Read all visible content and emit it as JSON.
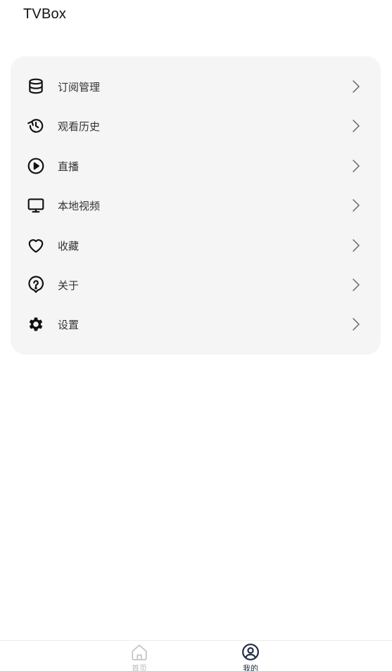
{
  "app": {
    "title": "TVBox"
  },
  "menu": {
    "items": [
      {
        "label": "订阅管理",
        "icon": "database-icon"
      },
      {
        "label": "观看历史",
        "icon": "history-icon"
      },
      {
        "label": "直播",
        "icon": "play-circle-icon"
      },
      {
        "label": "本地视频",
        "icon": "monitor-icon"
      },
      {
        "label": "收藏",
        "icon": "heart-icon"
      },
      {
        "label": "关于",
        "icon": "help-icon"
      },
      {
        "label": "设置",
        "icon": "gear-icon"
      }
    ]
  },
  "bottom_nav": {
    "items": [
      {
        "label": "首页",
        "icon": "home-icon",
        "active": false
      },
      {
        "label": "我的",
        "icon": "user-circle-icon",
        "active": true
      }
    ]
  },
  "colors": {
    "card_background": "#f5f5f5",
    "active_nav": "#1f2a44",
    "inactive_nav": "#b8b8b8"
  }
}
